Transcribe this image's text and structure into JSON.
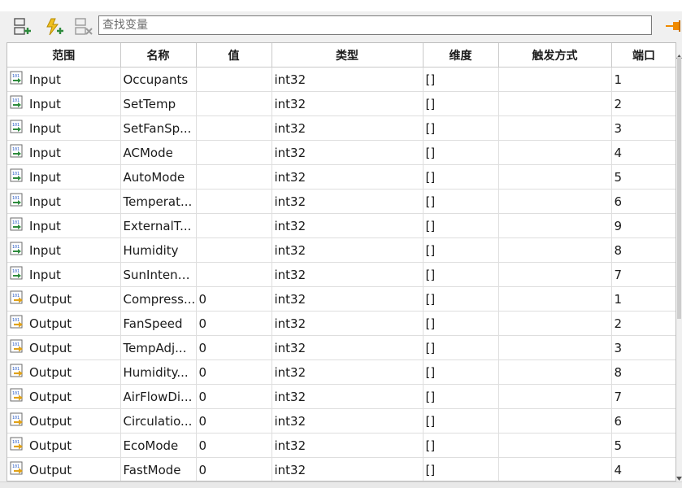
{
  "toolbar": {
    "buttons": [
      {
        "icon": "add-variable-icon"
      },
      {
        "icon": "add-trigger-icon"
      },
      {
        "icon": "delete-variable-icon"
      }
    ],
    "search_placeholder": "查找变量",
    "pin_icon": "pin-icon"
  },
  "table": {
    "columns": [
      "范围",
      "名称",
      "值",
      "类型",
      "维度",
      "触发方式",
      "端口"
    ],
    "rows": [
      {
        "scope": "Input",
        "name": "Occupants",
        "value": "",
        "type": "int32",
        "dim": "[]",
        "trigger": "",
        "port": "1"
      },
      {
        "scope": "Input",
        "name": "SetTemp",
        "value": "",
        "type": "int32",
        "dim": "[]",
        "trigger": "",
        "port": "2"
      },
      {
        "scope": "Input",
        "name": "SetFanSp...",
        "value": "",
        "type": "int32",
        "dim": "[]",
        "trigger": "",
        "port": "3"
      },
      {
        "scope": "Input",
        "name": "ACMode",
        "value": "",
        "type": "int32",
        "dim": "[]",
        "trigger": "",
        "port": "4"
      },
      {
        "scope": "Input",
        "name": "AutoMode",
        "value": "",
        "type": "int32",
        "dim": "[]",
        "trigger": "",
        "port": "5"
      },
      {
        "scope": "Input",
        "name": "Temperat...",
        "value": "",
        "type": "int32",
        "dim": "[]",
        "trigger": "",
        "port": "6"
      },
      {
        "scope": "Input",
        "name": "ExternalT...",
        "value": "",
        "type": "int32",
        "dim": "[]",
        "trigger": "",
        "port": "9"
      },
      {
        "scope": "Input",
        "name": "Humidity",
        "value": "",
        "type": "int32",
        "dim": "[]",
        "trigger": "",
        "port": "8"
      },
      {
        "scope": "Input",
        "name": "SunIntens...",
        "value": "",
        "type": "int32",
        "dim": "[]",
        "trigger": "",
        "port": "7"
      },
      {
        "scope": "Output",
        "name": "Compress...",
        "value": "0",
        "type": "int32",
        "dim": "[]",
        "trigger": "",
        "port": "1"
      },
      {
        "scope": "Output",
        "name": "FanSpeed",
        "value": "0",
        "type": "int32",
        "dim": "[]",
        "trigger": "",
        "port": "2"
      },
      {
        "scope": "Output",
        "name": "TempAdj...",
        "value": "0",
        "type": "int32",
        "dim": "[]",
        "trigger": "",
        "port": "3"
      },
      {
        "scope": "Output",
        "name": "Humidity...",
        "value": "0",
        "type": "int32",
        "dim": "[]",
        "trigger": "",
        "port": "8"
      },
      {
        "scope": "Output",
        "name": "AirFlowDi...",
        "value": "0",
        "type": "int32",
        "dim": "[]",
        "trigger": "",
        "port": "7"
      },
      {
        "scope": "Output",
        "name": "Circulatio...",
        "value": "0",
        "type": "int32",
        "dim": "[]",
        "trigger": "",
        "port": "6"
      },
      {
        "scope": "Output",
        "name": "EcoMode",
        "value": "0",
        "type": "int32",
        "dim": "[]",
        "trigger": "",
        "port": "5"
      },
      {
        "scope": "Output",
        "name": "FastMode",
        "value": "0",
        "type": "int32",
        "dim": "[]",
        "trigger": "",
        "port": "4"
      }
    ]
  },
  "colors": {
    "input_icon_accent": "#2e8b3d",
    "output_icon_accent": "#e0a21a",
    "pin_accent": "#f08a00"
  }
}
